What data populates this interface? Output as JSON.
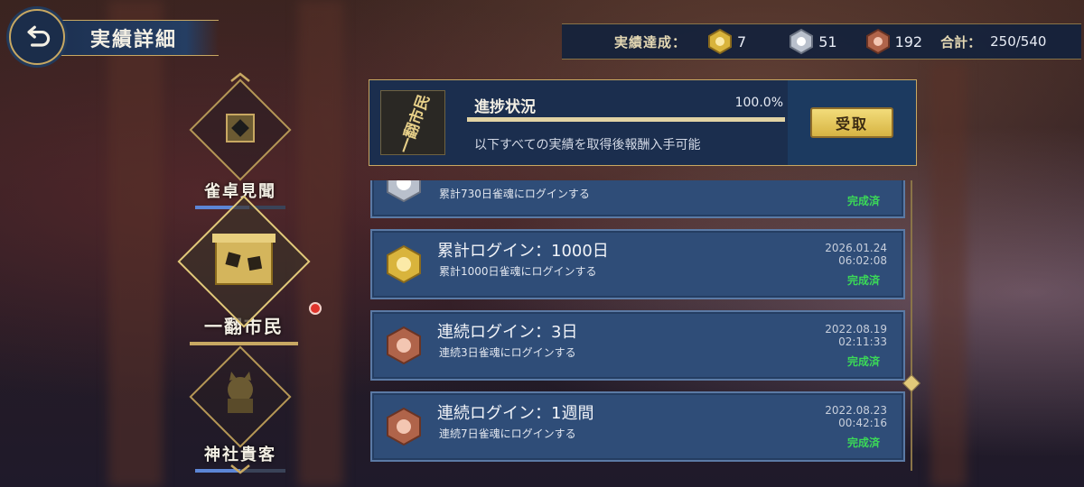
{
  "header": {
    "title": "実績詳細"
  },
  "stats": {
    "label": "実績達成：",
    "gold_count": "7",
    "silver_count": "51",
    "bronze_count": "192",
    "total_label": "合計：",
    "total_value": "250/540"
  },
  "categories": [
    {
      "label": "雀卓見聞",
      "progress": 0.6
    },
    {
      "label": "一翻市民",
      "progress": 1.0,
      "has_notification": true
    },
    {
      "label": "神社貴客",
      "progress": 0.5
    }
  ],
  "progress_panel": {
    "thumb_text": "一翻市民",
    "title": "進捗状況",
    "percent": "100.0%",
    "progress": 1.0,
    "description": "以下すべての実績を取得後報酬入手可能",
    "claim_label": "受取"
  },
  "achievements": [
    {
      "title": "",
      "description": "累計730日雀魂にログインする",
      "date": "",
      "time": "",
      "status": "完成済",
      "medal": "silver"
    },
    {
      "title": "累計ログイン：1000日",
      "description": "累計1000日雀魂にログインする",
      "date": "2026.01.24",
      "time": "06:02:08",
      "status": "完成済",
      "medal": "gold"
    },
    {
      "title": "連続ログイン：3日",
      "description": "連続3日雀魂にログインする",
      "date": "2022.08.19",
      "time": "02:11:33",
      "status": "完成済",
      "medal": "bronze"
    },
    {
      "title": "連続ログイン：1週間",
      "description": "連続7日雀魂にログインする",
      "date": "2022.08.23",
      "time": "00:42:16",
      "status": "完成済",
      "medal": "bronze"
    }
  ],
  "colors": {
    "gold": "#d9b43c",
    "silver": "#b9c0cc",
    "bronze": "#b0644a",
    "accent": "#c8a862",
    "complete": "#3bd957"
  }
}
